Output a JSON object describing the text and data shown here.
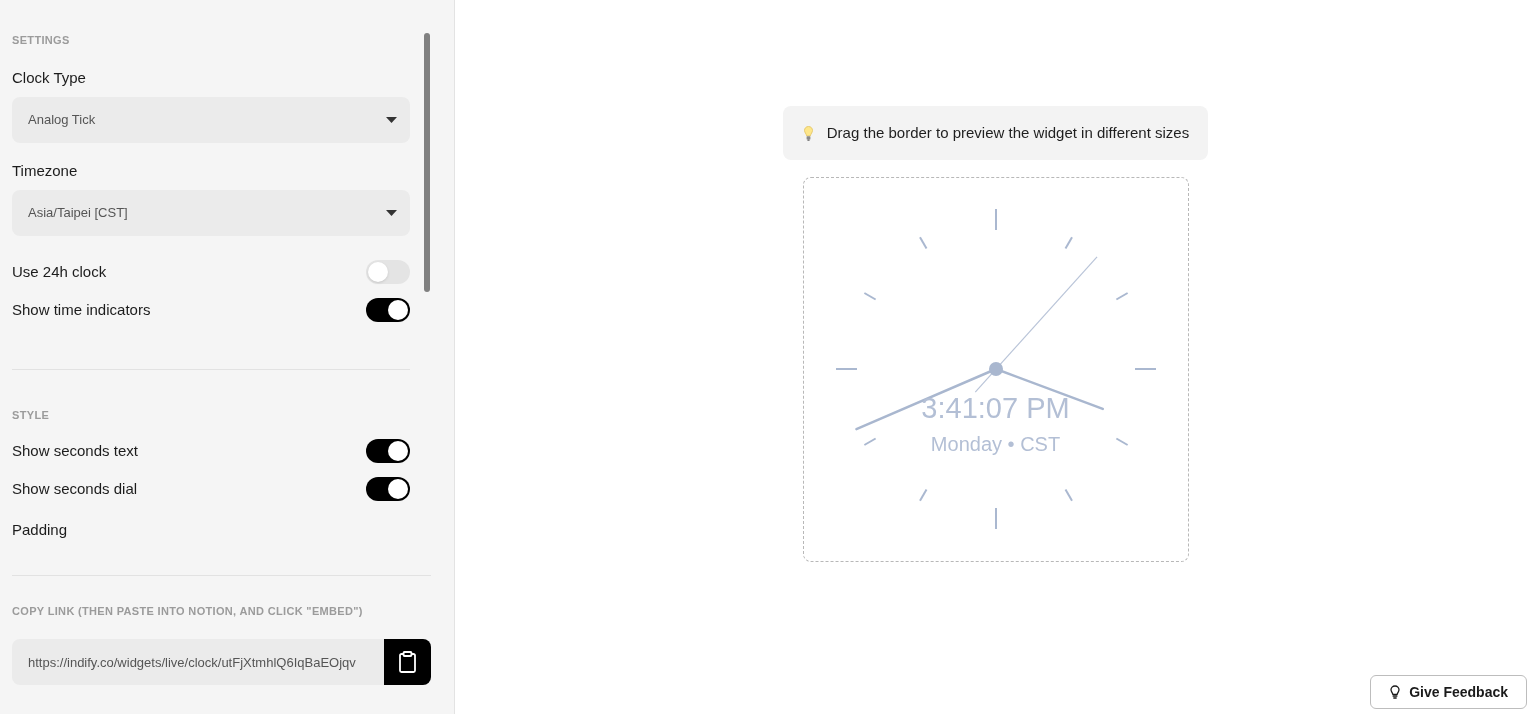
{
  "sidebar": {
    "sections": [
      {
        "heading": "SETTINGS",
        "items": [
          {
            "kind": "select",
            "label": "Clock Type",
            "value": "Analog Tick"
          },
          {
            "kind": "select",
            "label": "Timezone",
            "value": "Asia/Taipei [CST]"
          },
          {
            "kind": "toggle",
            "label": "Use 24h clock",
            "on": false
          },
          {
            "kind": "toggle",
            "label": "Show time indicators",
            "on": true
          }
        ]
      },
      {
        "heading": "STYLE",
        "items": [
          {
            "kind": "toggle",
            "label": "Show seconds text",
            "on": true
          },
          {
            "kind": "toggle",
            "label": "Show seconds dial",
            "on": true
          },
          {
            "kind": "label",
            "label": "Padding"
          }
        ]
      },
      {
        "heading": "COPY LINK (THEN PASTE INTO NOTION, AND CLICK \"EMBED\")",
        "items": [
          {
            "kind": "link",
            "value": "https://indify.co/widgets/live/clock/utFjXtmhlQ6IqBaEOjqv"
          }
        ]
      }
    ]
  },
  "preview": {
    "tip": "Drag the border to preview the widget in different sizes",
    "clock": {
      "time": "3:41:07 PM",
      "caption": "Monday • CST"
    }
  },
  "feedback_button": {
    "label": "Give Feedback"
  }
}
